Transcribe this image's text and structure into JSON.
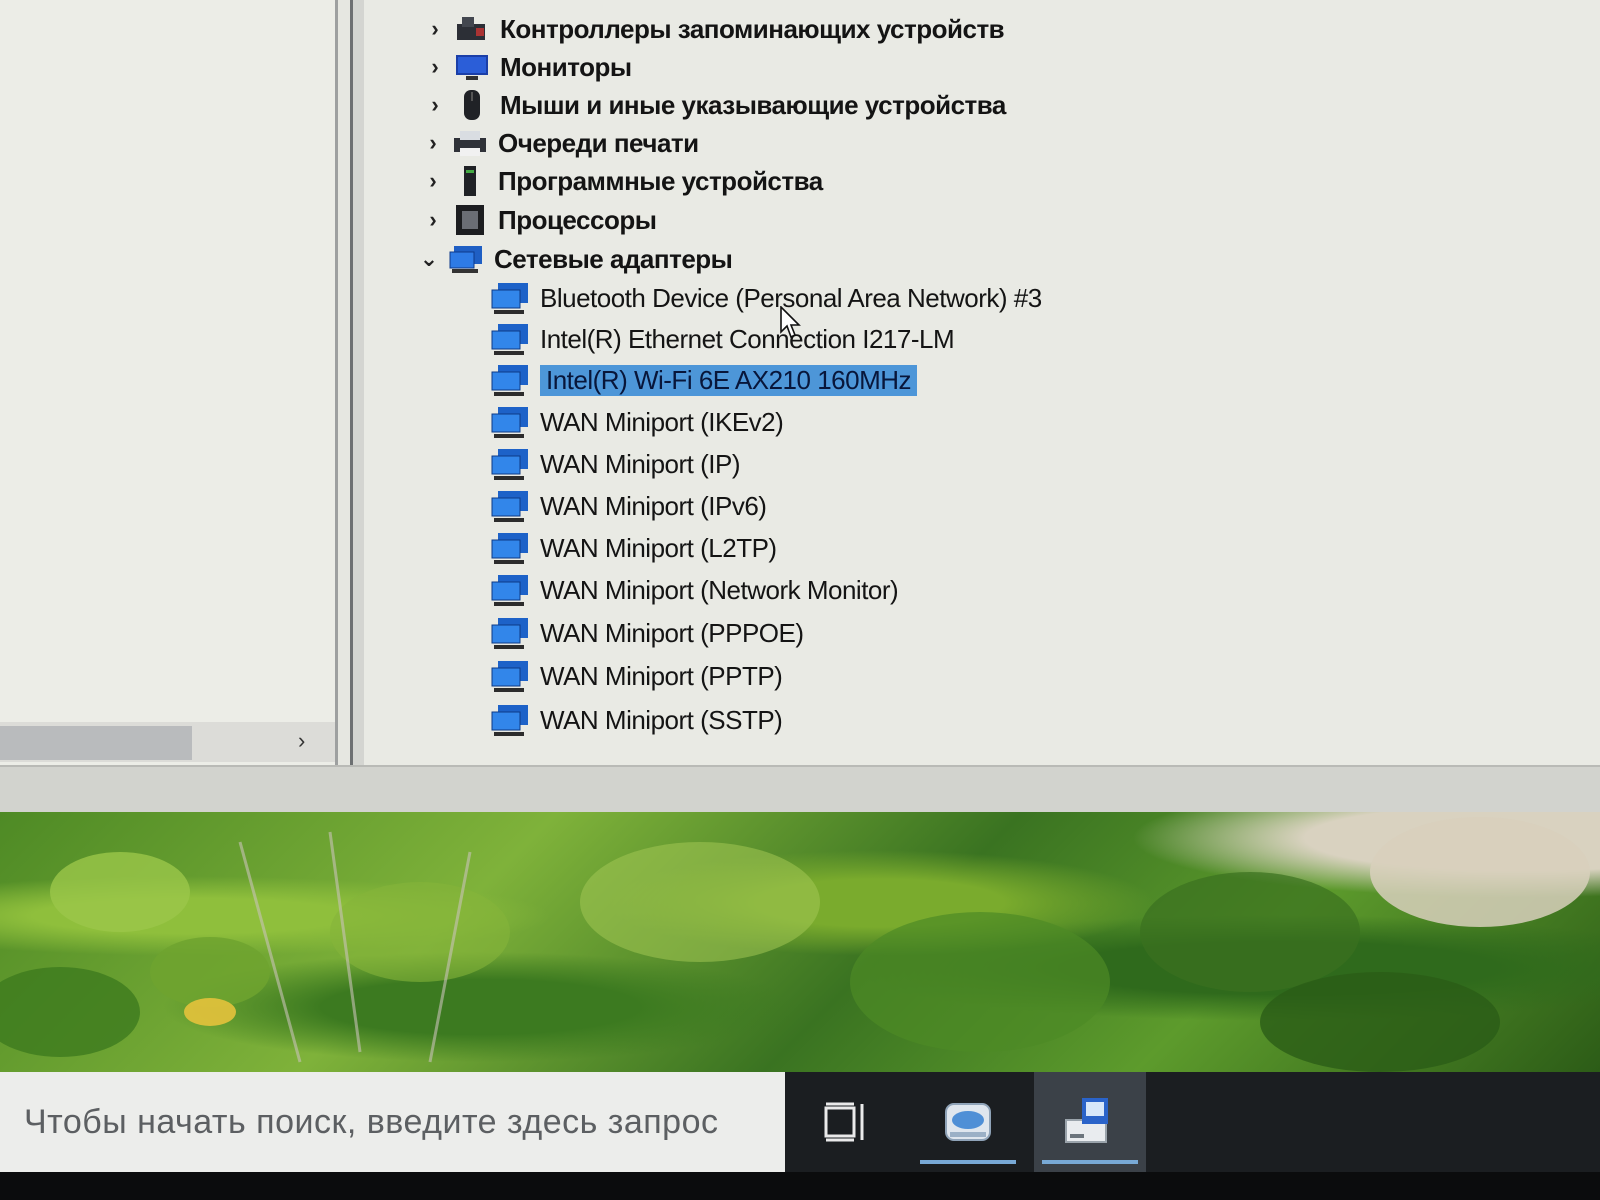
{
  "device_manager": {
    "categories": [
      {
        "label": "Контроллеры запоминающих устройств",
        "expanded": false,
        "icon": "storage-controller-icon"
      },
      {
        "label": "Мониторы",
        "expanded": false,
        "icon": "monitor-icon"
      },
      {
        "label": "Мыши и иные указывающие устройства",
        "expanded": false,
        "icon": "mouse-icon"
      },
      {
        "label": "Очереди печати",
        "expanded": false,
        "icon": "printer-icon"
      },
      {
        "label": "Программные устройства",
        "expanded": false,
        "icon": "software-device-icon"
      },
      {
        "label": "Процессоры",
        "expanded": false,
        "icon": "processor-icon"
      },
      {
        "label": "Сетевые адаптеры",
        "expanded": true,
        "icon": "network-adapter-icon"
      }
    ],
    "network_adapters": [
      {
        "label": "Bluetooth Device (Personal Area Network) #3",
        "selected": false
      },
      {
        "label": "Intel(R) Ethernet Connection I217-LM",
        "selected": false
      },
      {
        "label": "Intel(R) Wi-Fi 6E AX210 160MHz",
        "selected": true
      },
      {
        "label": "WAN Miniport (IKEv2)",
        "selected": false
      },
      {
        "label": "WAN Miniport (IP)",
        "selected": false
      },
      {
        "label": "WAN Miniport (IPv6)",
        "selected": false
      },
      {
        "label": "WAN Miniport (L2TP)",
        "selected": false
      },
      {
        "label": "WAN Miniport (Network Monitor)",
        "selected": false
      },
      {
        "label": "WAN Miniport (PPPOE)",
        "selected": false
      },
      {
        "label": "WAN Miniport (PPTP)",
        "selected": false
      },
      {
        "label": "WAN Miniport (SSTP)",
        "selected": false
      }
    ],
    "colors": {
      "selection": "#4d96d8",
      "network_icon": "#1e6fd0",
      "background": "#e9eae4"
    }
  },
  "taskbar": {
    "search_placeholder": "Чтобы начать поиск, введите здесь запрос",
    "buttons": [
      {
        "icon": "task-view-icon",
        "active": false
      },
      {
        "icon": "disk-drive-icon",
        "active": false,
        "running": true
      },
      {
        "icon": "device-manager-icon",
        "active": true,
        "running": true
      }
    ]
  }
}
